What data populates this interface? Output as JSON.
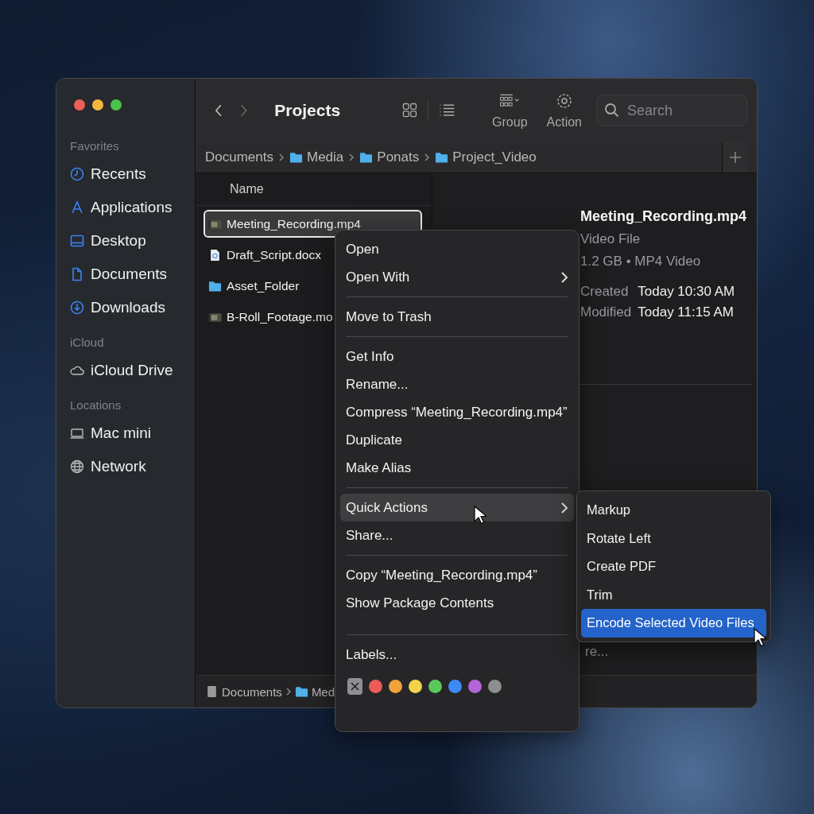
{
  "window": {
    "title": "Projects",
    "toolbar": [
      {
        "kind": "grid"
      },
      {
        "kind": "list"
      },
      {
        "kind": "group",
        "label": "Group"
      },
      {
        "kind": "action",
        "label": "Action"
      }
    ],
    "search": {
      "placeholder": "Search"
    }
  },
  "sidebar": [
    {
      "heading": "Favorites",
      "items": [
        {
          "label": "Recents",
          "kind": "clock"
        },
        {
          "label": "Applications",
          "kind": "apps"
        },
        {
          "label": "Desktop",
          "kind": "desktop"
        },
        {
          "label": "Documents",
          "kind": "doc"
        },
        {
          "label": "Downloads",
          "kind": "download"
        }
      ]
    },
    {
      "heading": "iCloud",
      "items": [
        {
          "label": "iCloud Drive",
          "kind": "cloud"
        }
      ]
    },
    {
      "heading": "Locations",
      "items": [
        {
          "label": "Mac mini",
          "kind": "computer"
        },
        {
          "label": "Network",
          "kind": "globe"
        }
      ]
    }
  ],
  "path_bar": [
    {
      "label": "Documents",
      "kind": "text"
    },
    {
      "label": "Media",
      "kind": "folder"
    },
    {
      "label": "Ponats",
      "kind": "folder"
    },
    {
      "label": "Project_Video",
      "kind": "folder"
    }
  ],
  "file_list": {
    "column": "Name",
    "rows": [
      {
        "name": "Meeting_Recording.mp4",
        "kind": "video",
        "selected": true
      },
      {
        "name": "Draft_Script.docx",
        "kind": "doc",
        "selected": false
      },
      {
        "name": "Asset_Folder",
        "kind": "folder",
        "selected": false
      },
      {
        "name": "B-Roll_Footage.mo",
        "kind": "video",
        "selected": false
      }
    ]
  },
  "preview": {
    "title": "Meeting_Recording.mp4",
    "type": "Video File",
    "size": "1.2 GB • MP4 Video",
    "dates": [
      {
        "label": "Created",
        "value": "Today 10:30 AM"
      },
      {
        "label": "Modified",
        "value": "Today 11:15 AM"
      }
    ],
    "more": "re..."
  },
  "status_path": [
    {
      "label": "Documents",
      "kind": "disk"
    },
    {
      "label": "Med",
      "kind": "folder"
    }
  ],
  "context_menu": {
    "items": [
      {
        "kind": "item",
        "label": "Open",
        "selected": false
      },
      {
        "kind": "submenu",
        "label": "Open With",
        "selected": false
      },
      {
        "kind": "separator"
      },
      {
        "kind": "item",
        "label": "Move to Trash",
        "selected": false
      },
      {
        "kind": "separator"
      },
      {
        "kind": "item",
        "label": "Get Info",
        "selected": false
      },
      {
        "kind": "item",
        "label": "Rename...",
        "selected": false
      },
      {
        "kind": "item",
        "label": "Compress “Meeting_Recording.mp4”",
        "selected": false
      },
      {
        "kind": "item",
        "label": "Duplicate",
        "selected": false
      },
      {
        "kind": "item",
        "label": "Make Alias",
        "selected": false
      },
      {
        "kind": "separator"
      },
      {
        "kind": "submenu",
        "label": "Quick Actions",
        "selected": true
      },
      {
        "kind": "item",
        "label": "Share...",
        "selected": false
      },
      {
        "kind": "separator"
      },
      {
        "kind": "item",
        "label": "Copy “Meeting_Recording.mp4”",
        "selected": false
      },
      {
        "kind": "item",
        "label": "Show Package Contents",
        "selected": false
      },
      {
        "kind": "separator"
      },
      {
        "kind": "item",
        "label": "Labels...",
        "selected": false
      }
    ],
    "tags": [
      {
        "kind": "none",
        "color": "#8e8e93"
      },
      {
        "kind": "color",
        "color": "#ec5b56"
      },
      {
        "kind": "color",
        "color": "#f0a23b"
      },
      {
        "kind": "color",
        "color": "#f2d34a"
      },
      {
        "kind": "color",
        "color": "#5ac85a"
      },
      {
        "kind": "color",
        "color": "#3d8af7"
      },
      {
        "kind": "color",
        "color": "#b565d9"
      },
      {
        "kind": "color",
        "color": "#8e8e8e"
      }
    ]
  },
  "submenu": {
    "items": [
      {
        "label": "Markup",
        "selected": false
      },
      {
        "label": "Rotate Left",
        "selected": false
      },
      {
        "label": "Create PDF",
        "selected": false
      },
      {
        "label": "Trim",
        "selected": false
      },
      {
        "label": "Encode Selected Video Files",
        "selected": true
      }
    ]
  }
}
